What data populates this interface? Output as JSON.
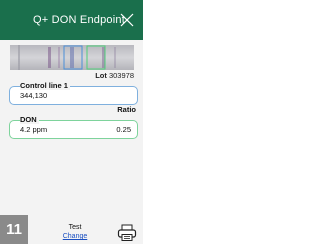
{
  "header": {
    "title": "Q+ DON Endpoint",
    "close_icon": "close-icon",
    "background": "#1a6f4c"
  },
  "lot": {
    "label": "Lot",
    "value": "303978"
  },
  "control_line": {
    "label": "Control line 1",
    "value": "344,130",
    "border_color": "#7fb0de"
  },
  "don": {
    "label": "DON",
    "value": "4.2 ppm",
    "ratio_label": "Ratio",
    "ratio_value": "0.25",
    "border_color": "#7ed39c"
  },
  "footer": {
    "number": "11",
    "test_label": "Test",
    "change_link": "Change",
    "print_icon": "printer-icon"
  }
}
